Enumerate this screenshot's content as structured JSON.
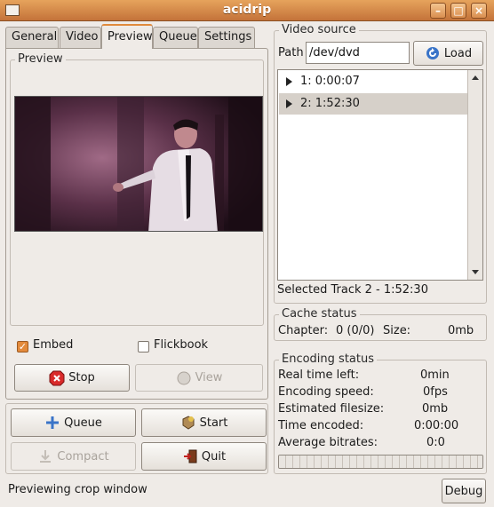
{
  "window": {
    "title": "acidrip"
  },
  "tabs": [
    {
      "label": "General"
    },
    {
      "label": "Video"
    },
    {
      "label": "Preview",
      "active": true
    },
    {
      "label": "Queue"
    },
    {
      "label": "Settings"
    }
  ],
  "preview": {
    "frame_label": "Preview",
    "embed_label": "Embed",
    "embed_checked": true,
    "flickbook_label": "Flickbook",
    "flickbook_checked": false,
    "stop_label": "Stop",
    "view_label": "View"
  },
  "actions": {
    "queue_label": "Queue",
    "start_label": "Start",
    "compact_label": "Compact",
    "quit_label": "Quit"
  },
  "video_source": {
    "frame_label": "Video source",
    "path_label": "Path",
    "path_value": "/dev/dvd",
    "load_label": "Load",
    "tracks": [
      {
        "label": "1: 0:00:07",
        "selected": false
      },
      {
        "label": "2: 1:52:30",
        "selected": true
      }
    ],
    "selected_text": "Selected Track 2 - 1:52:30"
  },
  "cache_status": {
    "frame_label": "Cache status",
    "chapter_label": "Chapter:",
    "chapter_value": "0 (0/0)",
    "size_label": "Size:",
    "size_value": "0mb"
  },
  "encoding_status": {
    "frame_label": "Encoding status",
    "rows": [
      {
        "label": "Real time left:",
        "value": "0min"
      },
      {
        "label": "Encoding speed:",
        "value": "0fps"
      },
      {
        "label": "Estimated filesize:",
        "value": "0mb"
      },
      {
        "label": "Time encoded:",
        "value": "0:00:00"
      },
      {
        "label": "Average bitrates:",
        "value": "0:0"
      }
    ],
    "progress": 0
  },
  "statusbar": {
    "message": "Previewing crop window",
    "debug_label": "Debug"
  },
  "colors": {
    "accent": "#e08a3c",
    "titlebar": "#d0843f",
    "selection": "#d6d0c9"
  }
}
